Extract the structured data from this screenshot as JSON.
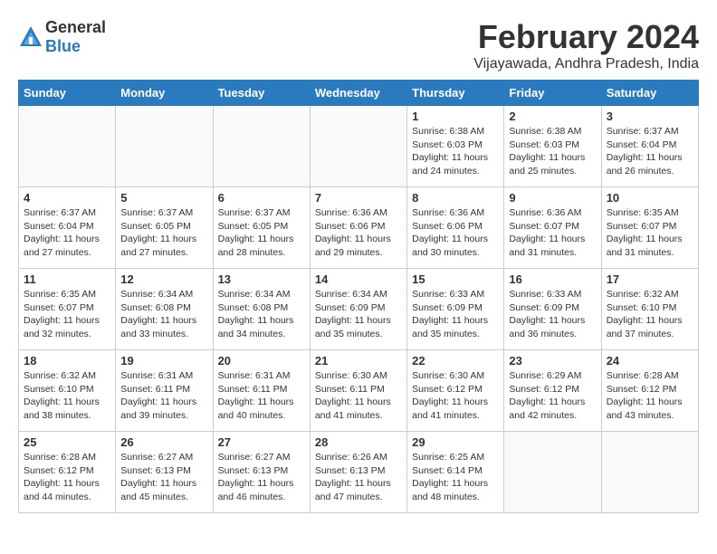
{
  "logo": {
    "general": "General",
    "blue": "Blue"
  },
  "title": "February 2024",
  "location": "Vijayawada, Andhra Pradesh, India",
  "days_of_week": [
    "Sunday",
    "Monday",
    "Tuesday",
    "Wednesday",
    "Thursday",
    "Friday",
    "Saturday"
  ],
  "weeks": [
    [
      {
        "day": "",
        "info": ""
      },
      {
        "day": "",
        "info": ""
      },
      {
        "day": "",
        "info": ""
      },
      {
        "day": "",
        "info": ""
      },
      {
        "day": "1",
        "info": "Sunrise: 6:38 AM\nSunset: 6:03 PM\nDaylight: 11 hours\nand 24 minutes."
      },
      {
        "day": "2",
        "info": "Sunrise: 6:38 AM\nSunset: 6:03 PM\nDaylight: 11 hours\nand 25 minutes."
      },
      {
        "day": "3",
        "info": "Sunrise: 6:37 AM\nSunset: 6:04 PM\nDaylight: 11 hours\nand 26 minutes."
      }
    ],
    [
      {
        "day": "4",
        "info": "Sunrise: 6:37 AM\nSunset: 6:04 PM\nDaylight: 11 hours\nand 27 minutes."
      },
      {
        "day": "5",
        "info": "Sunrise: 6:37 AM\nSunset: 6:05 PM\nDaylight: 11 hours\nand 27 minutes."
      },
      {
        "day": "6",
        "info": "Sunrise: 6:37 AM\nSunset: 6:05 PM\nDaylight: 11 hours\nand 28 minutes."
      },
      {
        "day": "7",
        "info": "Sunrise: 6:36 AM\nSunset: 6:06 PM\nDaylight: 11 hours\nand 29 minutes."
      },
      {
        "day": "8",
        "info": "Sunrise: 6:36 AM\nSunset: 6:06 PM\nDaylight: 11 hours\nand 30 minutes."
      },
      {
        "day": "9",
        "info": "Sunrise: 6:36 AM\nSunset: 6:07 PM\nDaylight: 11 hours\nand 31 minutes."
      },
      {
        "day": "10",
        "info": "Sunrise: 6:35 AM\nSunset: 6:07 PM\nDaylight: 11 hours\nand 31 minutes."
      }
    ],
    [
      {
        "day": "11",
        "info": "Sunrise: 6:35 AM\nSunset: 6:07 PM\nDaylight: 11 hours\nand 32 minutes."
      },
      {
        "day": "12",
        "info": "Sunrise: 6:34 AM\nSunset: 6:08 PM\nDaylight: 11 hours\nand 33 minutes."
      },
      {
        "day": "13",
        "info": "Sunrise: 6:34 AM\nSunset: 6:08 PM\nDaylight: 11 hours\nand 34 minutes."
      },
      {
        "day": "14",
        "info": "Sunrise: 6:34 AM\nSunset: 6:09 PM\nDaylight: 11 hours\nand 35 minutes."
      },
      {
        "day": "15",
        "info": "Sunrise: 6:33 AM\nSunset: 6:09 PM\nDaylight: 11 hours\nand 35 minutes."
      },
      {
        "day": "16",
        "info": "Sunrise: 6:33 AM\nSunset: 6:09 PM\nDaylight: 11 hours\nand 36 minutes."
      },
      {
        "day": "17",
        "info": "Sunrise: 6:32 AM\nSunset: 6:10 PM\nDaylight: 11 hours\nand 37 minutes."
      }
    ],
    [
      {
        "day": "18",
        "info": "Sunrise: 6:32 AM\nSunset: 6:10 PM\nDaylight: 11 hours\nand 38 minutes."
      },
      {
        "day": "19",
        "info": "Sunrise: 6:31 AM\nSunset: 6:11 PM\nDaylight: 11 hours\nand 39 minutes."
      },
      {
        "day": "20",
        "info": "Sunrise: 6:31 AM\nSunset: 6:11 PM\nDaylight: 11 hours\nand 40 minutes."
      },
      {
        "day": "21",
        "info": "Sunrise: 6:30 AM\nSunset: 6:11 PM\nDaylight: 11 hours\nand 41 minutes."
      },
      {
        "day": "22",
        "info": "Sunrise: 6:30 AM\nSunset: 6:12 PM\nDaylight: 11 hours\nand 41 minutes."
      },
      {
        "day": "23",
        "info": "Sunrise: 6:29 AM\nSunset: 6:12 PM\nDaylight: 11 hours\nand 42 minutes."
      },
      {
        "day": "24",
        "info": "Sunrise: 6:28 AM\nSunset: 6:12 PM\nDaylight: 11 hours\nand 43 minutes."
      }
    ],
    [
      {
        "day": "25",
        "info": "Sunrise: 6:28 AM\nSunset: 6:12 PM\nDaylight: 11 hours\nand 44 minutes."
      },
      {
        "day": "26",
        "info": "Sunrise: 6:27 AM\nSunset: 6:13 PM\nDaylight: 11 hours\nand 45 minutes."
      },
      {
        "day": "27",
        "info": "Sunrise: 6:27 AM\nSunset: 6:13 PM\nDaylight: 11 hours\nand 46 minutes."
      },
      {
        "day": "28",
        "info": "Sunrise: 6:26 AM\nSunset: 6:13 PM\nDaylight: 11 hours\nand 47 minutes."
      },
      {
        "day": "29",
        "info": "Sunrise: 6:25 AM\nSunset: 6:14 PM\nDaylight: 11 hours\nand 48 minutes."
      },
      {
        "day": "",
        "info": ""
      },
      {
        "day": "",
        "info": ""
      }
    ]
  ]
}
